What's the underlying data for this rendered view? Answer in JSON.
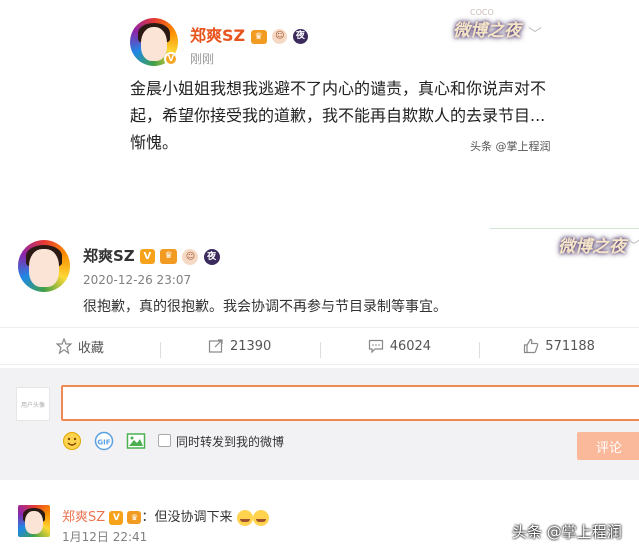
{
  "top_post": {
    "username": "郑爽SZ",
    "time": "刚刚",
    "body": "金晨小姐姐我想我逃避不了内心的谴责，真心和你说声对不起，希望你接受我的道歉，我不能再自欺欺人的去录节目...惭愧。",
    "watermark": "头条 @掌上程润",
    "event_logo": "微博之夜",
    "event_logo_small": "COCO"
  },
  "post": {
    "username": "郑爽SZ",
    "time": "2020-12-26 23:07",
    "body": "很抱歉，真的很抱歉。我会协调不再参与节目录制等事宜。",
    "event_logo": "微博之夜",
    "badges": {
      "verified": "V",
      "night": "夜"
    }
  },
  "actions": {
    "favorite": "收藏",
    "repost": "21390",
    "comment": "46024",
    "like": "571188"
  },
  "comment_box": {
    "input_value": "",
    "avatar_caption": "用户头像",
    "repost_checkbox_label": "同时转发到我的微博",
    "submit_label": "评论",
    "tools": [
      "smile-icon",
      "gif-icon",
      "image-icon"
    ]
  },
  "reply": {
    "username": "郑爽SZ",
    "separator": "：",
    "text": "但没协调下来",
    "time": "1月12日 22:41",
    "watermark": "头条 @掌上程润"
  },
  "colors": {
    "accent_orange": "#eb7350",
    "input_border": "#f08a55",
    "submit_bg": "#fbb99b",
    "verified_gold": "#f7a21b"
  }
}
